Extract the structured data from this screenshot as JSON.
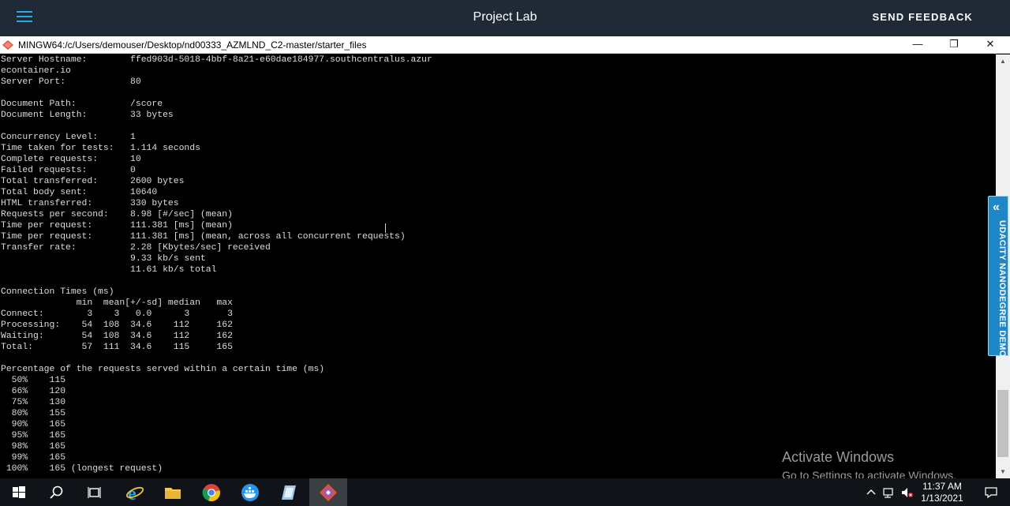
{
  "header": {
    "title": "Project Lab",
    "feedback_label": "SEND FEEDBACK"
  },
  "window": {
    "title": "MINGW64:/c/Users/demouser/Desktop/nd00333_AZMLND_C2-master/starter_files",
    "minimize": "—",
    "maximize": "❐",
    "close": "✕"
  },
  "terminal": {
    "lines": [
      "Server Hostname:        ffed903d-5018-4bbf-8a21-e60dae184977.southcentralus.azur",
      "econtainer.io",
      "Server Port:            80",
      "",
      "Document Path:          /score",
      "Document Length:        33 bytes",
      "",
      "Concurrency Level:      1",
      "Time taken for tests:   1.114 seconds",
      "Complete requests:      10",
      "Failed requests:        0",
      "Total transferred:      2600 bytes",
      "Total body sent:        10640",
      "HTML transferred:       330 bytes",
      "Requests per second:    8.98 [#/sec] (mean)",
      "Time per request:       111.381 [ms] (mean)",
      "Time per request:       111.381 [ms] (mean, across all concurrent requests)",
      "Transfer rate:          2.28 [Kbytes/sec] received",
      "                        9.33 kb/s sent",
      "                        11.61 kb/s total",
      "",
      "Connection Times (ms)",
      "              min  mean[+/-sd] median   max",
      "Connect:        3    3   0.0      3       3",
      "Processing:    54  108  34.6    112     162",
      "Waiting:       54  108  34.6    112     162",
      "Total:         57  111  34.6    115     165",
      "",
      "Percentage of the requests served within a certain time (ms)",
      "  50%    115",
      "  66%    120",
      "  75%    130",
      "  80%    155",
      "  90%    165",
      "  95%    165",
      "  98%    165",
      "  99%    165",
      " 100%    165 (longest request)"
    ]
  },
  "side_tab": {
    "label": "UDACITY NANODEGREE DEMO",
    "chevron": "«"
  },
  "watermark": {
    "title": "Activate Windows",
    "subtitle": "Go to Settings to activate Windows."
  },
  "taskbar": {
    "apps": [
      "start-icon",
      "search-icon",
      "task-view-icon",
      "internet-explorer-icon",
      "file-explorer-icon",
      "chrome-icon",
      "docker-icon",
      "notepad-icon",
      "git-bash-icon"
    ],
    "time": "11:37 AM",
    "date": "1/13/2021"
  },
  "colors": {
    "header_bg": "#1f2a36",
    "accent": "#2aa8e0",
    "side_tab": "#1e87c8",
    "terminal_bg": "#000000",
    "terminal_fg": "#dddddd"
  }
}
